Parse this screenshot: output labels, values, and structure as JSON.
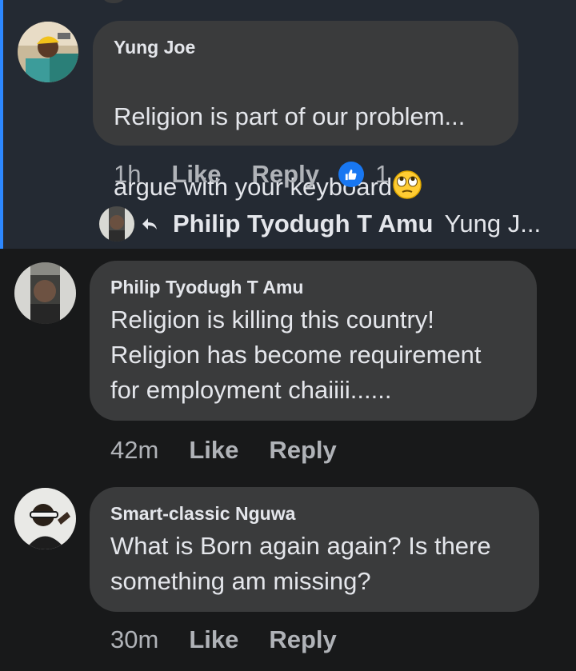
{
  "comments": [
    {
      "author": "Yung Joe",
      "text_line1": "Religion is part of our problem...",
      "text_line2": "argue with your keyboard",
      "emoji": "face-with-rolling-eyes",
      "time": "1h",
      "like_label": "Like",
      "reply_label": "Reply",
      "reaction_icon": "thumbs-up-icon",
      "reaction_count": "1",
      "reply_preview": {
        "author": "Philip Tyodugh T Amu",
        "snippet": "Yung J..."
      }
    },
    {
      "author": "Philip Tyodugh T Amu",
      "text": "Religion is killing this country!\nReligion has become requirement\nfor employment chaiiii......",
      "time": "42m",
      "like_label": "Like",
      "reply_label": "Reply"
    },
    {
      "author": "Smart-classic Nguwa",
      "text": "What is Born again again? Is there\nsomething am missing?",
      "time": "30m",
      "like_label": "Like",
      "reply_label": "Reply"
    }
  ],
  "colors": {
    "background": "#18191a",
    "highlighted_background": "#242a33",
    "bubble": "#3a3b3c",
    "accent": "#2d88ff",
    "secondary_text": "#b0b3b8",
    "like_blue": "#1877f2"
  }
}
